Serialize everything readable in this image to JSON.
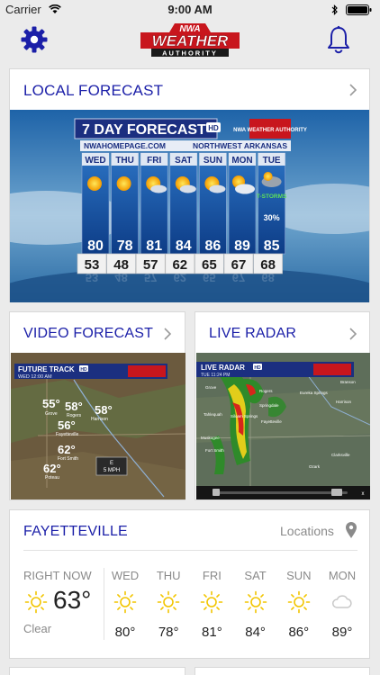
{
  "status_bar": {
    "carrier": "Carrier",
    "time": "9:00 AM"
  },
  "header": {
    "logo_top": "NWA",
    "logo_main": "WEATHER",
    "logo_sub": "AUTHORITY",
    "settings_icon": "gear-icon",
    "alerts_icon": "bell-icon"
  },
  "local_forecast": {
    "title": "LOCAL FORECAST",
    "graphic": {
      "heading": "7 DAY FORECAST",
      "hd_badge": "HD",
      "badge": "NWA WEATHER AUTHORITY",
      "site": "NWAHOMEPAGE.COM",
      "region": "NORTHWEST ARKANSAS",
      "days": [
        {
          "day": "WED",
          "high": "80",
          "low": "53"
        },
        {
          "day": "THU",
          "high": "78",
          "low": "48"
        },
        {
          "day": "FRI",
          "high": "81",
          "low": "57"
        },
        {
          "day": "SAT",
          "high": "84",
          "low": "62"
        },
        {
          "day": "SUN",
          "high": "86",
          "low": "65"
        },
        {
          "day": "MON",
          "high": "89",
          "low": "67"
        },
        {
          "day": "TUE",
          "high": "85",
          "low": "68",
          "note": "T-STORMS",
          "chance": "30%"
        }
      ]
    }
  },
  "video_forecast": {
    "title": "VIDEO FORECAST",
    "graphic": {
      "label": "FUTURE TRACK",
      "hd_badge": "HD",
      "timestamp": "WED 12:00 AM",
      "places": [
        {
          "temp": "55°",
          "name": "Grove"
        },
        {
          "temp": "58°",
          "name": "Rogers"
        },
        {
          "temp": "58°",
          "name": "Harrison"
        },
        {
          "temp": "56°",
          "name": "Fayetteville"
        },
        {
          "temp": "62°",
          "name": "Fort Smith"
        },
        {
          "temp": "62°",
          "name": "Poteau"
        }
      ],
      "wind_dir": "E",
      "wind_speed": "5 MPH"
    }
  },
  "live_radar": {
    "title": "LIVE RADAR",
    "graphic": {
      "label": "LIVE RADAR",
      "hd_badge": "HD",
      "timestamp": "TUE 11:24 PM",
      "towns": [
        "Branson",
        "Eureka Springs",
        "Harrison",
        "Rogers",
        "Springdale",
        "Siloam Springs",
        "Fayetteville",
        "Fort Smith",
        "Clarksville",
        "Ozark",
        "Grove",
        "Tahlequah",
        "Muskogee"
      ]
    }
  },
  "current": {
    "city": "FAYETTEVILLE",
    "locations_label": "Locations",
    "now_label": "RIGHT NOW",
    "now_temp": "63°",
    "now_condition": "Clear",
    "days": [
      {
        "day": "WED",
        "temp": "80°",
        "icon": "sun-icon"
      },
      {
        "day": "THU",
        "temp": "78°",
        "icon": "sun-icon"
      },
      {
        "day": "FRI",
        "temp": "81°",
        "icon": "sun-icon"
      },
      {
        "day": "SAT",
        "temp": "84°",
        "icon": "sun-icon"
      },
      {
        "day": "SUN",
        "temp": "86°",
        "icon": "sun-icon"
      },
      {
        "day": "MON",
        "temp": "89°",
        "icon": "cloud-icon"
      }
    ]
  },
  "colors": {
    "accent": "#1b1fa8",
    "sun": "#f2c500",
    "logo_red": "#c8161d"
  }
}
